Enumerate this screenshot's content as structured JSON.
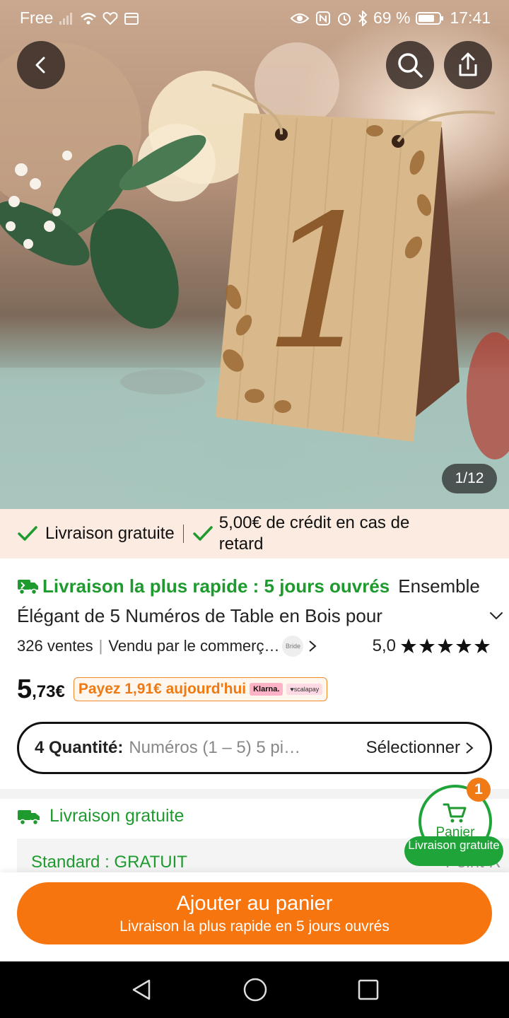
{
  "status_bar": {
    "carrier": "Free",
    "battery": "69 %",
    "time": "17:41"
  },
  "hero": {
    "counter": "1/12",
    "table_number": "1"
  },
  "promo": {
    "item1": "Livraison gratuite",
    "item2": "5,00€ de crédit en cas de retard"
  },
  "product": {
    "fast_delivery": "Livraison la plus rapide : 5 jours ouvrés",
    "title_part1": "Ensemble",
    "title_part2": "Élégant de 5 Numéros de Table en Bois pour",
    "sales": "326 ventes",
    "seller": "Vendu par le commerç…",
    "seller_badge": "Bride",
    "rating": "5,0",
    "price_main": "5",
    "price_decimal": ",73€",
    "pay_today": "Payez 1,91€ aujourd'hui",
    "klarna": "Klarna.",
    "scalapay": "♥scalapay"
  },
  "quantity": {
    "label": "4 Quantité:",
    "value": "Numéros (1 – 5) 5 pi…",
    "select": "Sélectionner"
  },
  "shipping": {
    "title": "Livraison gratuite",
    "standard": "Standard : GRATUIT",
    "point_relais": "Point R"
  },
  "cart": {
    "badge": "1",
    "label": "Panier",
    "pill": "Livraison gratuite"
  },
  "add_to_cart": {
    "main": "Ajouter au panier",
    "sub": "Livraison la plus rapide en 5 jours ouvrés"
  },
  "colors": {
    "accent_orange": "#f7750f",
    "green": "#1f9a2f",
    "promo_bg": "#fcebe0"
  }
}
